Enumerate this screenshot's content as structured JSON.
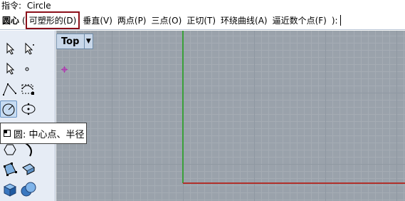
{
  "history": {
    "label": "指令:",
    "command": "Circle"
  },
  "command_prompt": {
    "name": "圆心",
    "paren_open": "(",
    "options": [
      {
        "label": "可塑形的(D)",
        "highlighted": true
      },
      {
        "label": "垂直(V)",
        "highlighted": false
      },
      {
        "label": "两点(P)",
        "highlighted": false
      },
      {
        "label": "三点(O)",
        "highlighted": false
      },
      {
        "label": "正切(T)",
        "highlighted": false
      },
      {
        "label": "环绕曲线(A)",
        "highlighted": false
      },
      {
        "label": "逼近数个点(F)",
        "highlighted": false
      }
    ],
    "suffix": "):"
  },
  "viewport": {
    "title": "Top",
    "menu_glyph": "▼"
  },
  "tooltip": {
    "text": "圆: 中心点、半径"
  },
  "toolbar": {
    "buttons": [
      "select-arrow-icon",
      "select-points-icon",
      "select-arrow-alt-icon",
      "point-icon",
      "polyline-icon",
      "curve-control-points-icon",
      "circle-center-radius-icon",
      "ellipse-icon",
      "polygon-icon",
      "curve-blend-icon",
      "surface-corner-points-icon",
      "extrude-surface-icon",
      "box-solid-icon",
      "sphere-solid-icon"
    ],
    "highlight_color": "#c7dcf2"
  },
  "colors": {
    "y_axis": "#3aa03a",
    "x_axis": "#b0302a",
    "highlight_border": "#8b0f1a",
    "viewport_bg": "#9aa2ab"
  }
}
